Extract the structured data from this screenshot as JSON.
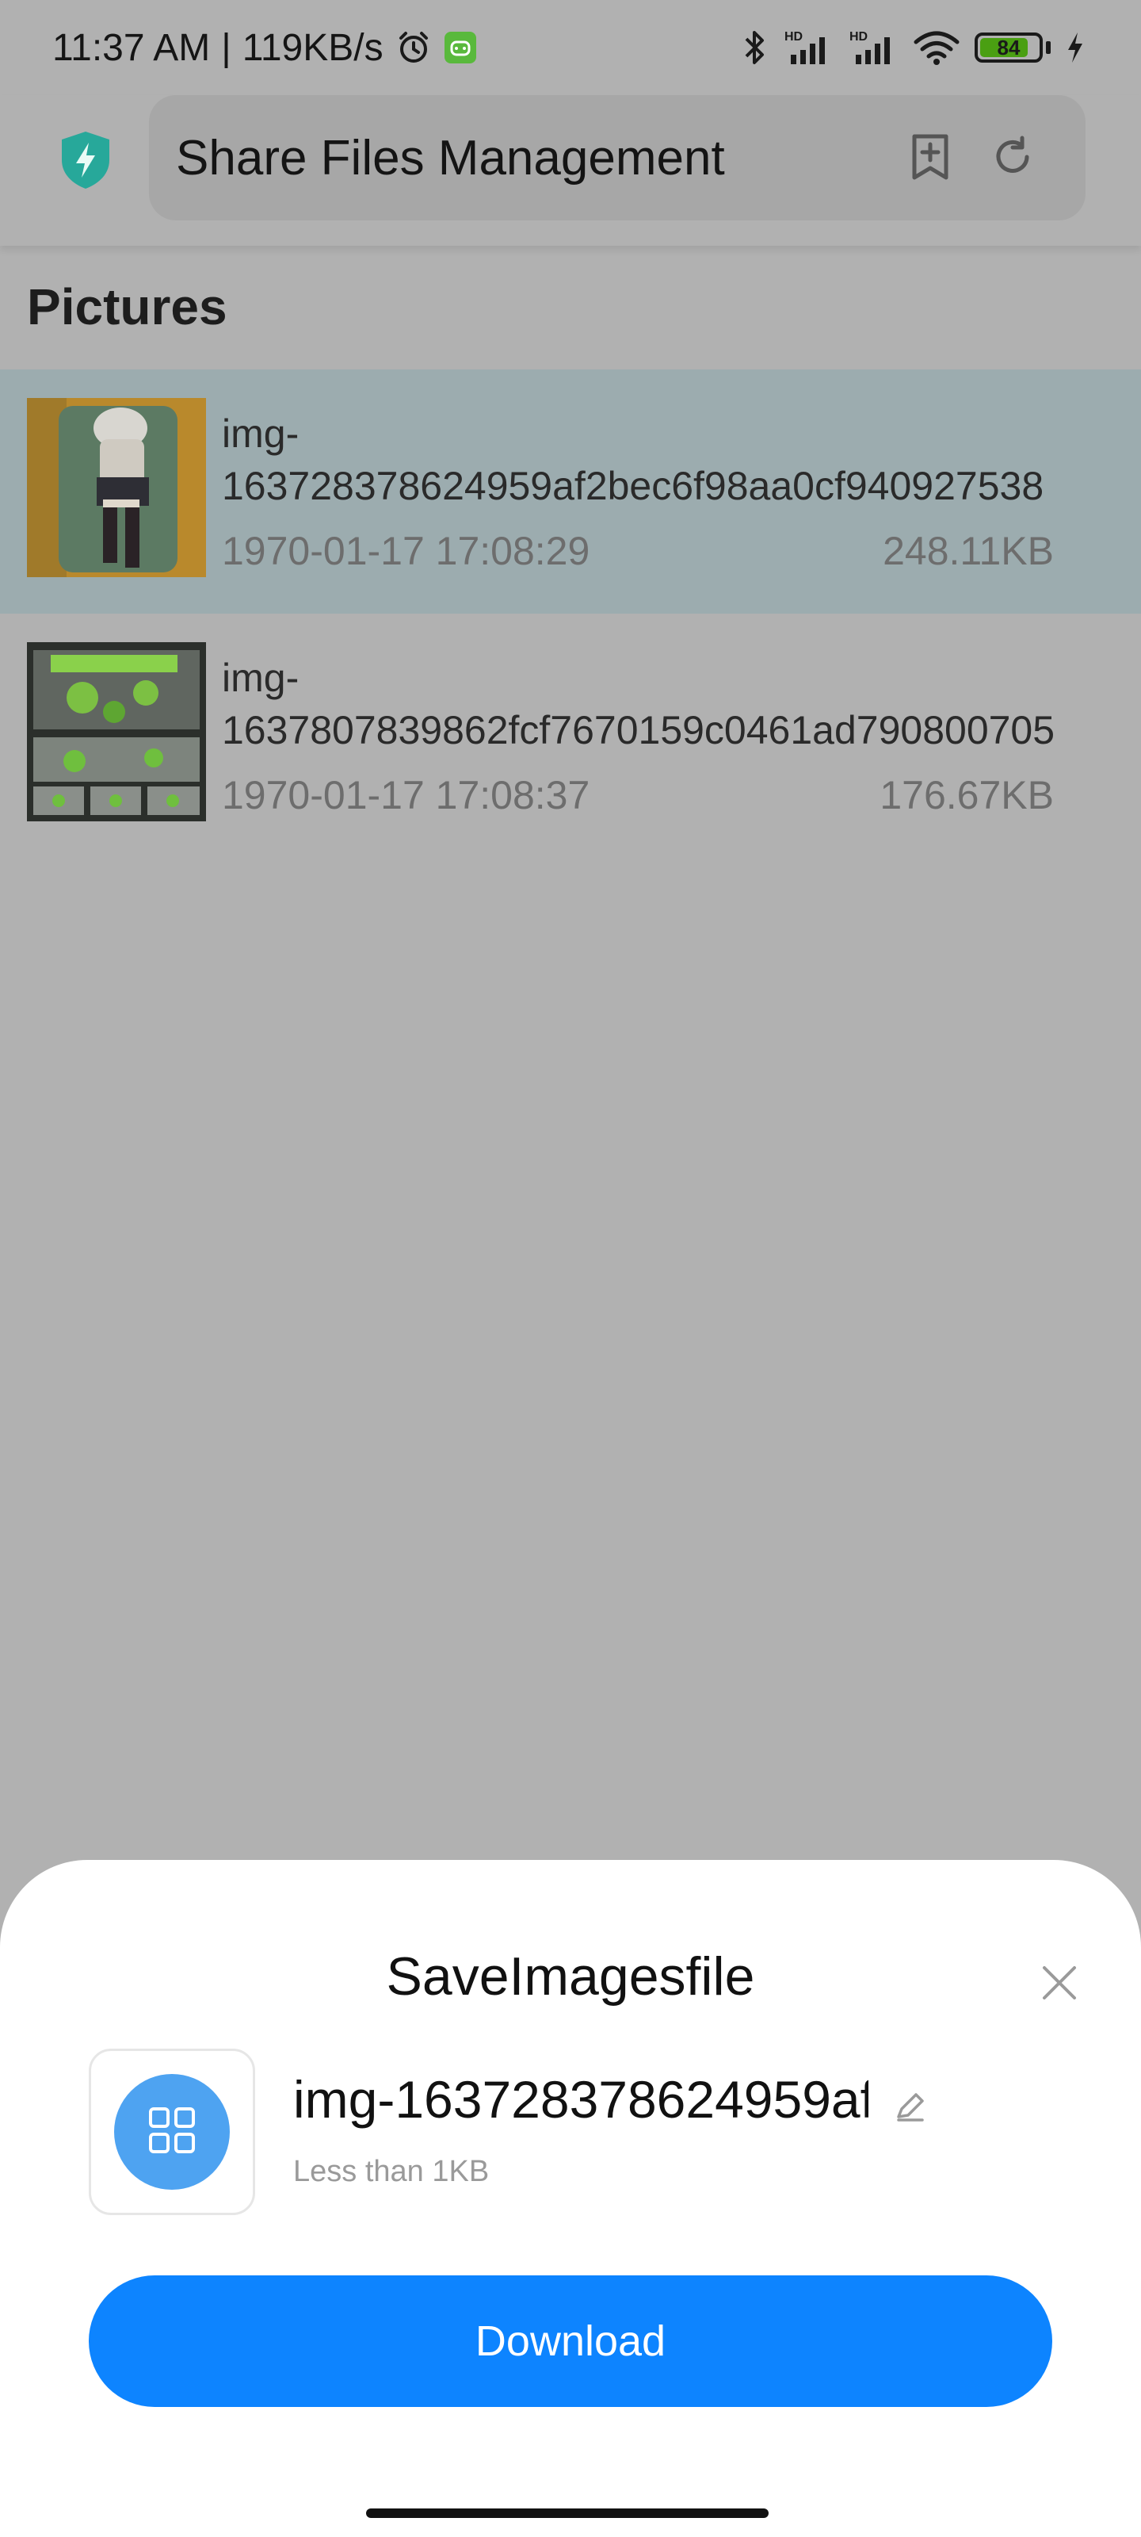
{
  "status_bar": {
    "time": "11:37 AM",
    "separator": "|",
    "network_speed": "119KB/s",
    "battery_level": "84",
    "battery_fraction": 0.84,
    "icons": [
      "alarm-icon",
      "android-app-icon",
      "bluetooth-icon",
      "hd-signal-icon",
      "hd-signal-icon",
      "wifi-icon",
      "battery-icon",
      "charging-icon"
    ]
  },
  "app_bar": {
    "title": "Share Files Management",
    "icons": [
      "shield-bolt-icon",
      "add-bookmark-icon",
      "refresh-icon"
    ]
  },
  "section": {
    "title": "Pictures"
  },
  "files": [
    {
      "name_line1": "img-",
      "name_line2": "163728378624959af2bec6f98aa0cf940927538",
      "date": "1970-01-17 17:08:29",
      "size": "248.11KB",
      "selected": true
    },
    {
      "name_line1": "img-",
      "name_line2": "1637807839862fcf7670159c0461ad790800705",
      "date": "1970-01-17 17:08:37",
      "size": "176.67KB",
      "selected": false
    }
  ],
  "sheet": {
    "title": "SaveImagesfile",
    "filename": "img-163728378624959af",
    "size_text": "Less than 1KB",
    "download_label": "Download"
  },
  "colors": {
    "accent": "#0d84ff",
    "file_icon": "#4ea3f1",
    "shield": "#27a89a",
    "selected_row": "#9cacaf",
    "dim_background": "#b1b1b1"
  }
}
